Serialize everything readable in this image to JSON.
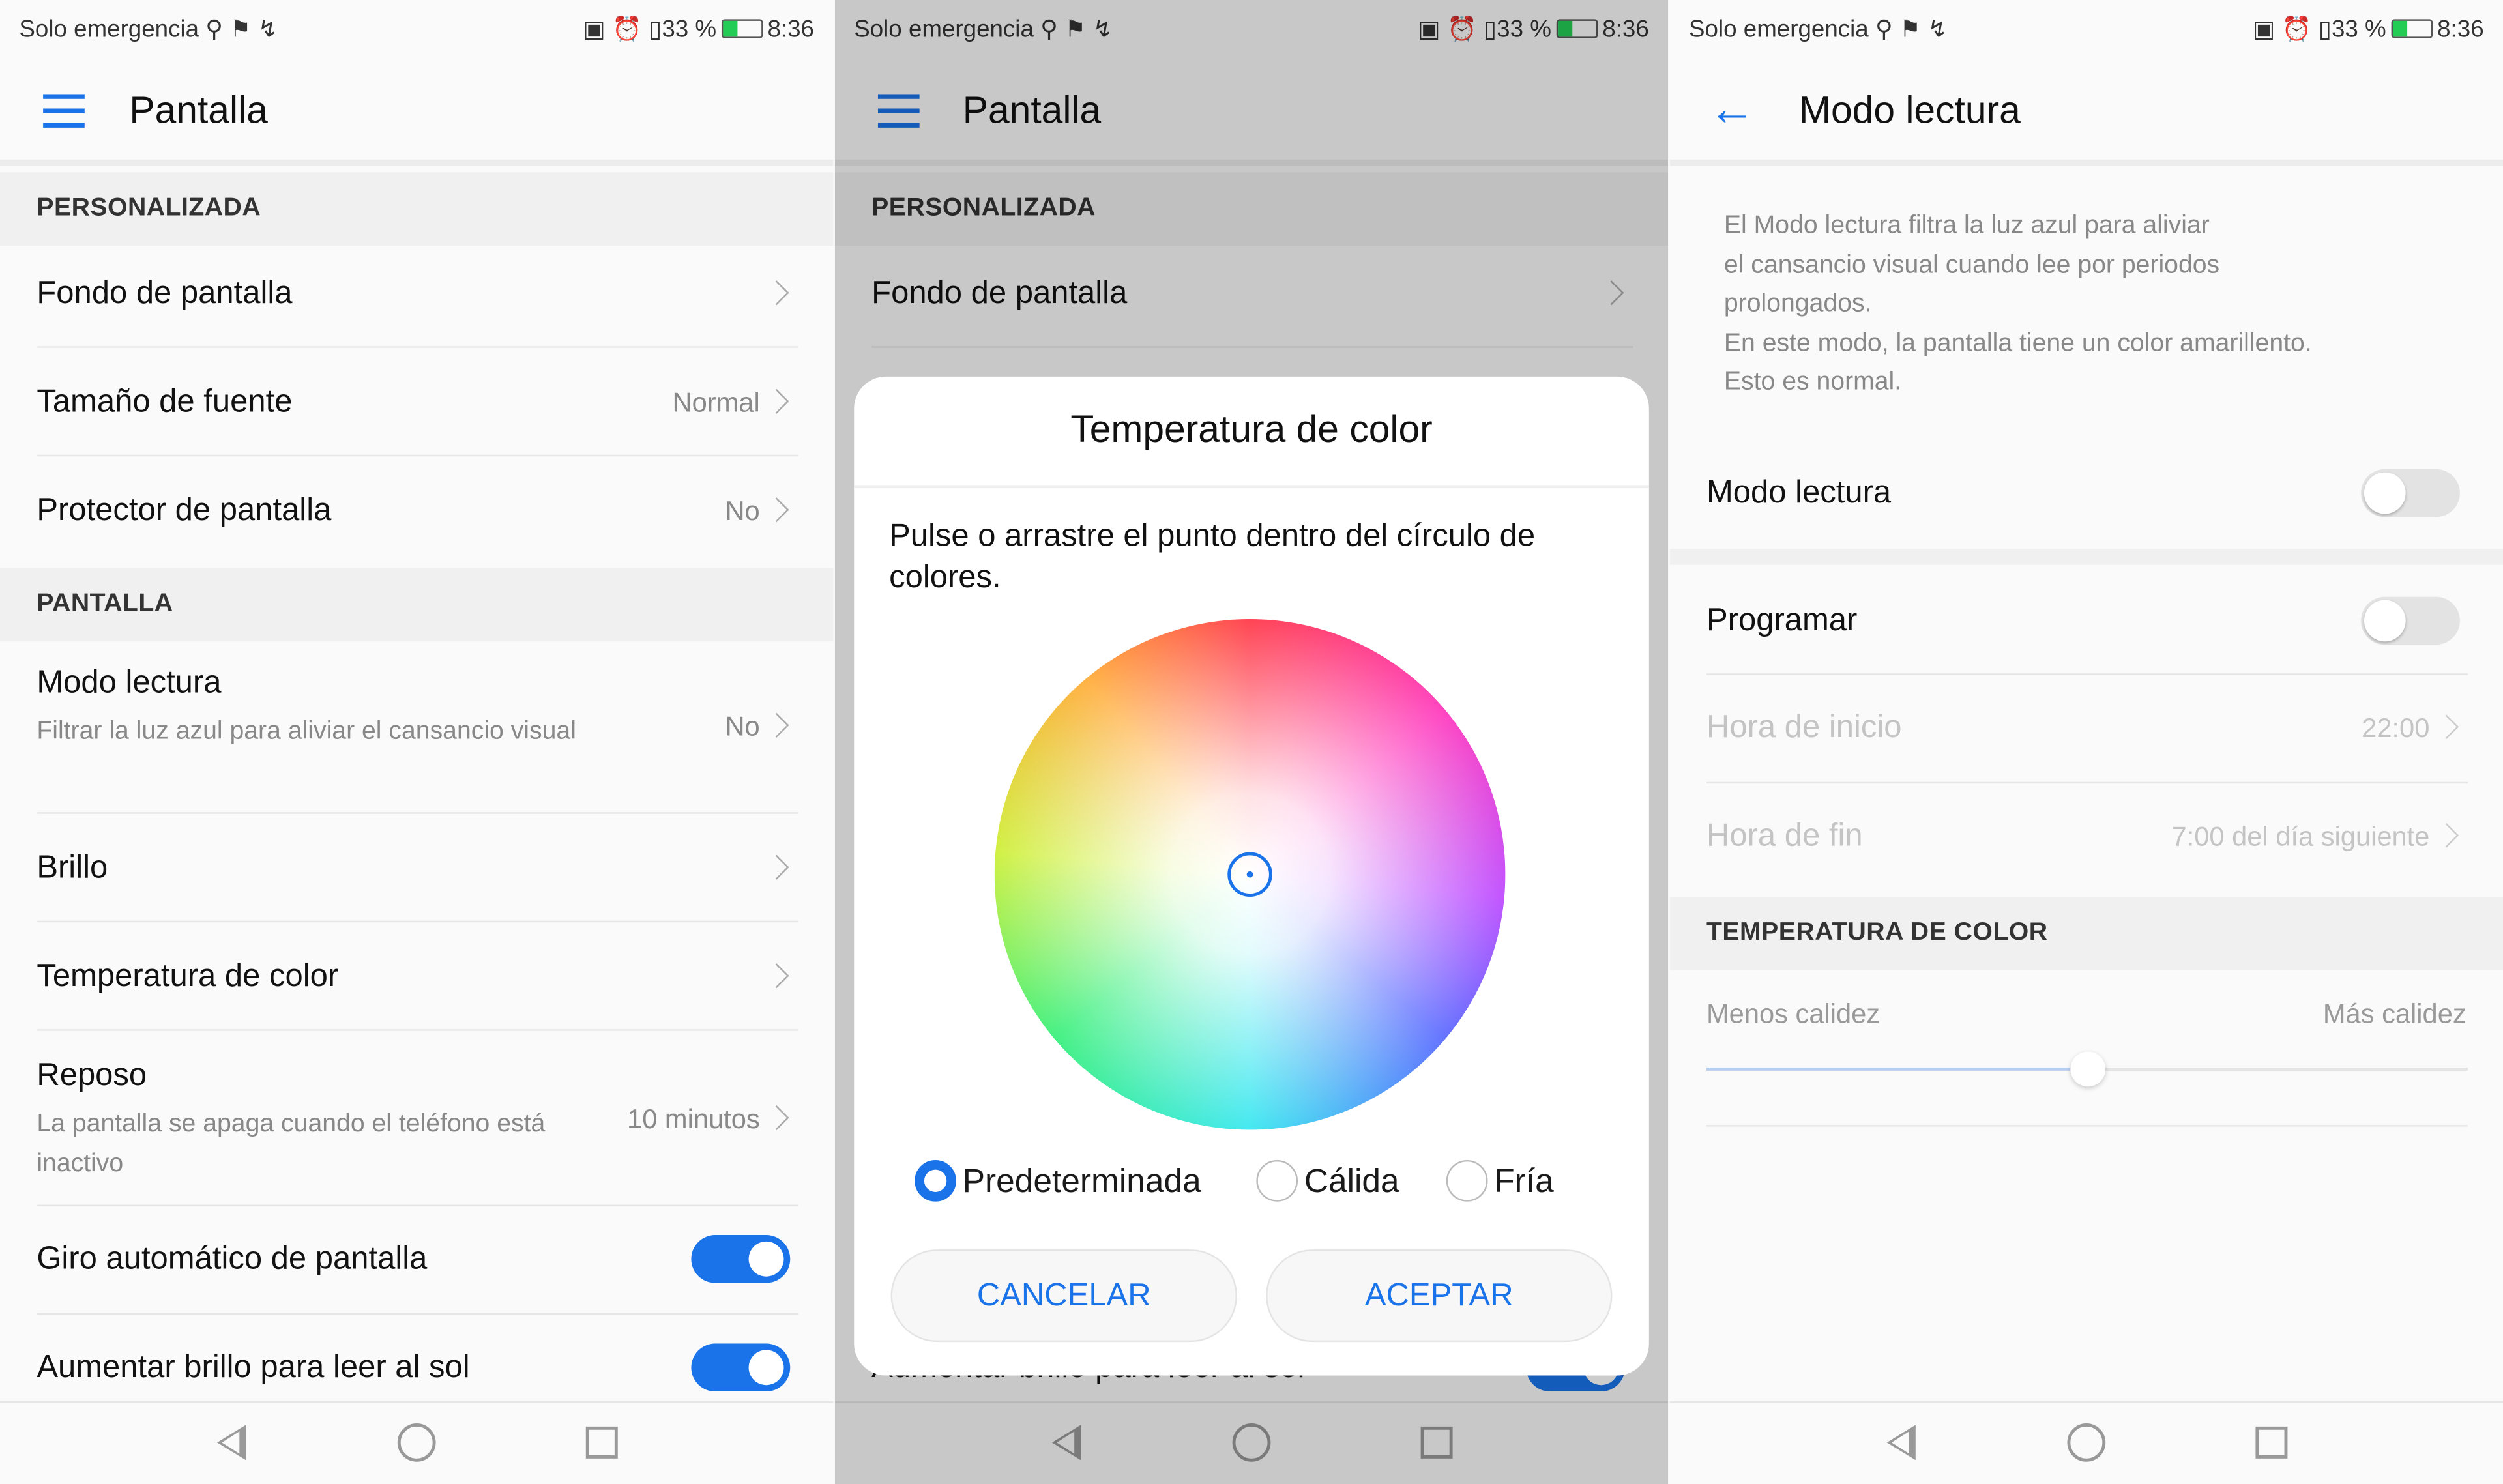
{
  "status": {
    "carrier": "Solo emergencia",
    "icons_left": [
      "location-icon",
      "nfc-flag-icon",
      "wifi-call-icon"
    ],
    "icons_right": [
      "nfc-icon",
      "alarm-icon",
      "vibrate-icon"
    ],
    "battery": "33 %",
    "battery_level": 0.33,
    "time": "8:36",
    "battery_color": "#22cc55"
  },
  "accent": "#1a73e8",
  "screen1": {
    "title": "Pantalla",
    "sections": [
      {
        "header": "PERSONALIZADA"
      },
      {
        "header": "PANTALLA"
      }
    ],
    "rows": [
      {
        "label": "Fondo de pantalla"
      },
      {
        "label": "Tamaño de fuente",
        "value": "Normal"
      },
      {
        "label": "Protector de pantalla",
        "value": "No"
      },
      {
        "label": "Modo lectura",
        "sub": "Filtrar la luz azul para aliviar el cansancio visual",
        "value": "No"
      },
      {
        "label": "Brillo"
      },
      {
        "label": "Temperatura de color"
      },
      {
        "label": "Reposo",
        "sub": "La pantalla se apaga cuando el teléfono está inactivo",
        "value": "10 minutos"
      },
      {
        "label": "Giro automático de pantalla",
        "toggle": true
      },
      {
        "label": "Aumentar brillo para leer al sol",
        "toggle": true
      }
    ]
  },
  "screen2": {
    "title": "Pantalla",
    "section": "PERSONALIZADA",
    "row": "Fondo de pantalla",
    "behind_row": "Aumentar brillo para leer al sol",
    "dialog": {
      "title": "Temperatura de color",
      "instructions": "Pulse o arrastre el punto dentro del círculo de colores.",
      "options": [
        {
          "label": "Predeterminada",
          "selected": true
        },
        {
          "label": "Cálida",
          "selected": false
        },
        {
          "label": "Fría",
          "selected": false
        }
      ],
      "cancel": "CANCELAR",
      "accept": "ACEPTAR"
    }
  },
  "screen3": {
    "title": "Modo lectura",
    "description": [
      "El Modo lectura filtra la luz azul para aliviar",
      "el cansancio visual cuando lee por periodos",
      "prolongados.",
      "En este modo, la pantalla tiene un color amarillento.",
      "Esto es normal."
    ],
    "modo_lectura": {
      "label": "Modo lectura",
      "on": false
    },
    "programar": {
      "label": "Programar",
      "on": false
    },
    "hora_inicio": {
      "label": "Hora de inicio",
      "value": "22:00"
    },
    "hora_fin": {
      "label": "Hora de fin",
      "value": "7:00 del día siguiente"
    },
    "temp_header": "TEMPERATURA DE COLOR",
    "slider": {
      "min_label": "Menos calidez",
      "max_label": "Más calidez",
      "value": 0.5
    }
  }
}
